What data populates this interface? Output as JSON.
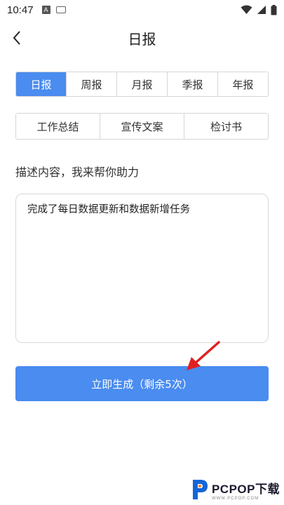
{
  "status_bar": {
    "time": "10:47",
    "a_icon_label": "A"
  },
  "header": {
    "title": "日报"
  },
  "report_period_tabs": [
    {
      "label": "日报",
      "active": true
    },
    {
      "label": "周报",
      "active": false
    },
    {
      "label": "月报",
      "active": false
    },
    {
      "label": "季报",
      "active": false
    },
    {
      "label": "年报",
      "active": false
    }
  ],
  "document_types": [
    {
      "label": "工作总结"
    },
    {
      "label": "宣传文案"
    },
    {
      "label": "检讨书"
    }
  ],
  "description": {
    "label": "描述内容，我来帮你助力",
    "value": "完成了每日数据更新和数据新增任务"
  },
  "generate_button": {
    "label": "立即生成（剩余5次）"
  },
  "watermark": {
    "text": "PCPOP下载",
    "subtext": "WWW.PCPOP.COM"
  },
  "colors": {
    "accent": "#4a8cf0",
    "annotation_arrow": "#e02020"
  }
}
